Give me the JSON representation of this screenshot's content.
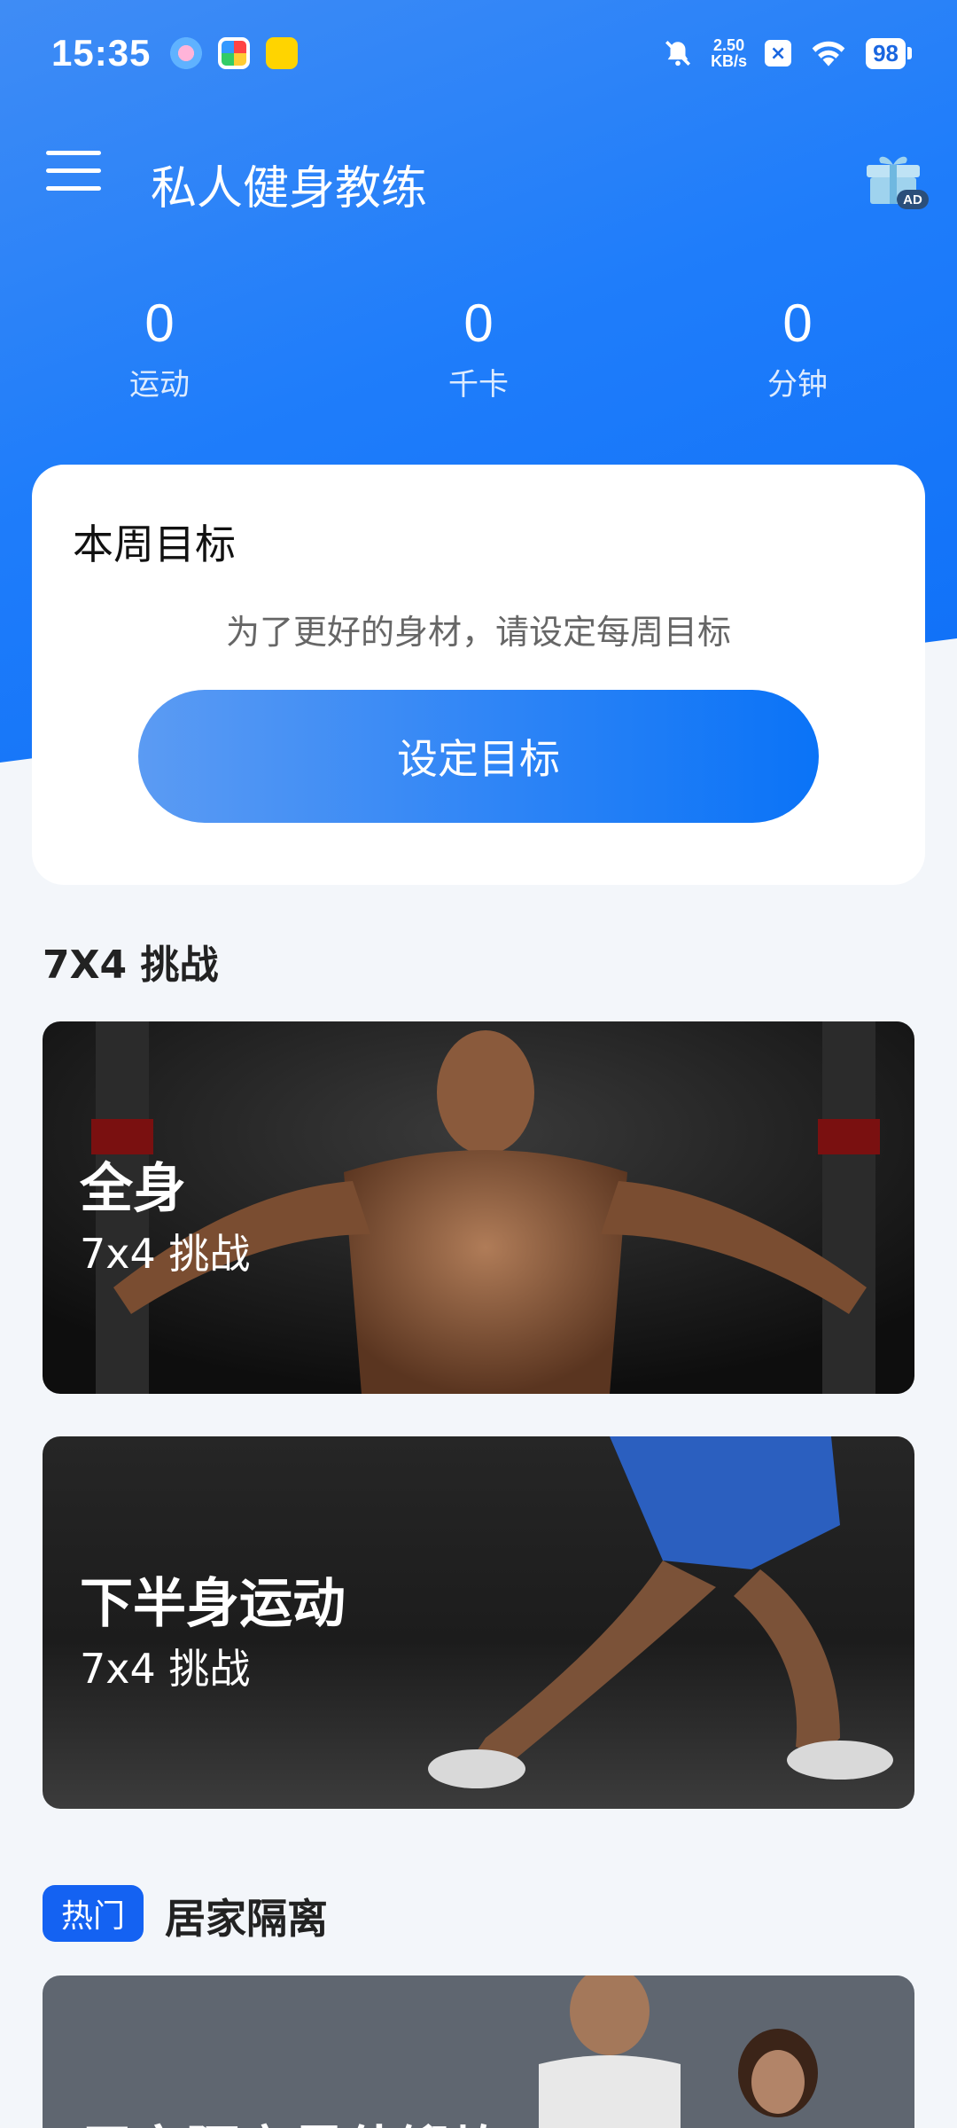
{
  "status_bar": {
    "time": "15:35",
    "net_speed_value": "2.50",
    "net_speed_unit": "KB/s",
    "battery": "98"
  },
  "app_bar": {
    "title": "私人健身教练",
    "ad_badge": "AD"
  },
  "stats": [
    {
      "value": "0",
      "label": "运动"
    },
    {
      "value": "0",
      "label": "千卡"
    },
    {
      "value": "0",
      "label": "分钟"
    }
  ],
  "weekly_goal": {
    "title": "本周目标",
    "description": "为了更好的身材，请设定每周目标",
    "button_label": "设定目标"
  },
  "challenge_section": {
    "title": "7X4 挑战",
    "cards": [
      {
        "title": "全身",
        "subtitle": "7x4 挑战"
      },
      {
        "title": "下半身运动",
        "subtitle": "7x4 挑战"
      }
    ]
  },
  "home_section": {
    "badge": "热门",
    "title": "居家隔离",
    "card_title": "居家隔离最佳锻炼"
  },
  "colors": {
    "primary": "#1f7dfa",
    "badge": "#1462f2",
    "background": "#f3f6fa"
  }
}
